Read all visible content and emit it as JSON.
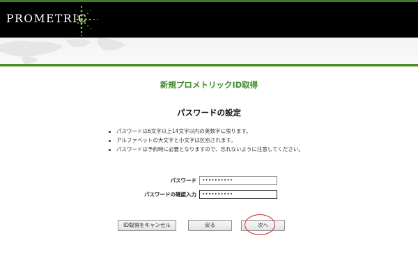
{
  "header": {
    "logo_text": "PROMETRIC",
    "brand_green": "#3f7d1f"
  },
  "page": {
    "title": "新規プロメトリックID取得",
    "section_title": "パスワードの設定"
  },
  "rules": [
    "パスワードは6文字以上14文字以内の英数字に限ります。",
    "アルファベットの大文字と小文字は区別されます。",
    "パスワードは予約時に必要となりますので、忘れないように注意してください。"
  ],
  "form": {
    "password_label": "パスワード",
    "password_value": "••••••••••",
    "confirm_label": "パスワードの確認入力",
    "confirm_value": "••••••••••"
  },
  "buttons": {
    "cancel": "ID取得をキャンセル",
    "back": "戻る",
    "next": "次へ"
  },
  "annotation": {
    "circle_color": "#c62828"
  }
}
